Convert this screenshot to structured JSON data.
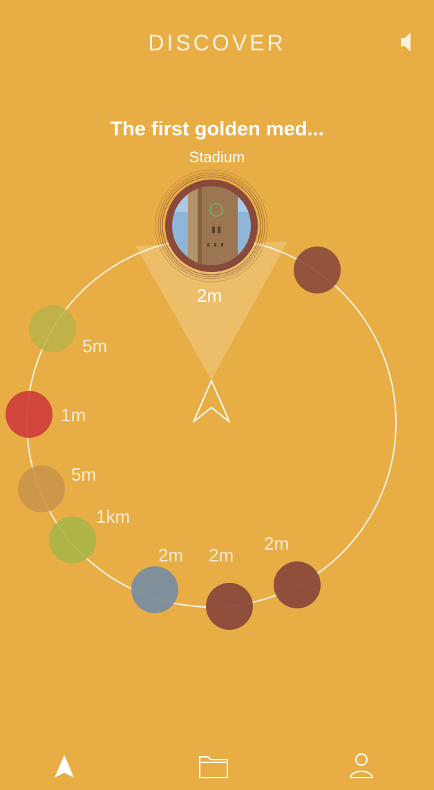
{
  "header": {
    "title": "DISCOVER",
    "sound_icon": "speaker-icon"
  },
  "featured": {
    "title": "The first golden med...",
    "category": "Stadium",
    "distance": "2m",
    "image": "clock-tower-photo"
  },
  "pois": [
    {
      "distance": "2m",
      "color": "#8A4A3A"
    },
    {
      "distance": "5m",
      "color": "#B9B24A"
    },
    {
      "distance": "1m",
      "color": "#D0403B"
    },
    {
      "distance": "5m",
      "color": "#C99548"
    },
    {
      "distance": "1km",
      "color": "#A9B548"
    },
    {
      "distance": "2m",
      "color": "#7A8D9E"
    },
    {
      "distance": "2m",
      "color": "#8A4A3A"
    },
    {
      "distance": "2m",
      "color": "#8A4A3A"
    }
  ],
  "tabbar": {
    "navigate_icon": "navigation-arrow-icon",
    "folder_icon": "folder-icon",
    "profile_icon": "user-icon"
  },
  "colors": {
    "background": "#E8AE45",
    "ring": "#FFFFFF",
    "featured_border": "#8A4A3A"
  }
}
